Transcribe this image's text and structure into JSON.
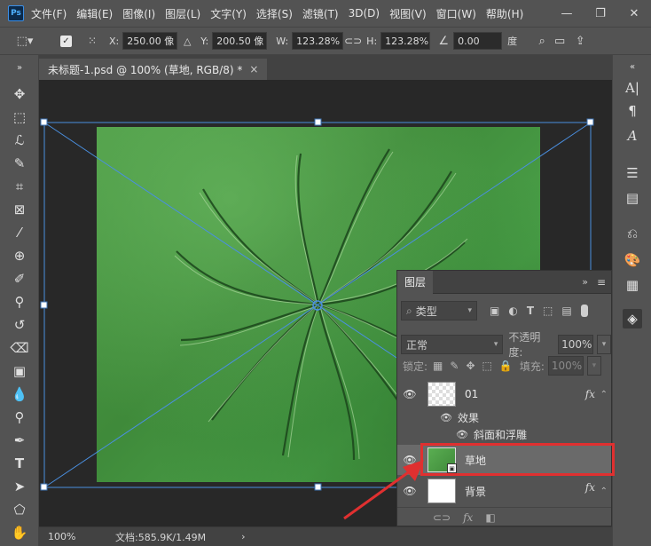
{
  "app": {
    "logo": "Ps",
    "menu": [
      "文件(F)",
      "编辑(E)",
      "图像(I)",
      "图层(L)",
      "文字(Y)",
      "选择(S)",
      "滤镜(T)",
      "3D(D)",
      "视图(V)",
      "窗口(W)",
      "帮助(H)"
    ]
  },
  "options": {
    "x_label": "X:",
    "x_value": "250.00 像",
    "y_label": "Y:",
    "y_value": "200.50 像",
    "w_label": "W:",
    "w_value": "123.28%",
    "h_label": "H:",
    "h_value": "123.28%",
    "angle_value": "0.00",
    "angle_unit": "度"
  },
  "document": {
    "tab_title": "未标题-1.psd @ 100% (草地, RGB/8) *",
    "tab_close": "×"
  },
  "status": {
    "zoom": "100%",
    "doc_info": "文档:585.9K/1.49M",
    "arrow": "›"
  },
  "layers_panel": {
    "tab_label": "图层",
    "filter_label": "类型",
    "blend_mode": "正常",
    "opacity_label": "不透明度:",
    "opacity_value": "100%",
    "lock_label": "锁定:",
    "fill_label": "填充:",
    "fill_value": "100%",
    "layers": [
      {
        "name": "01",
        "fx": "fx",
        "effects_label": "效果",
        "effect_item": "斜面和浮雕"
      },
      {
        "name": "草地"
      },
      {
        "name": "背景",
        "fx": "fx"
      }
    ]
  },
  "colors": {
    "highlight": "#e03030",
    "transform_line": "#4a8fe0"
  }
}
